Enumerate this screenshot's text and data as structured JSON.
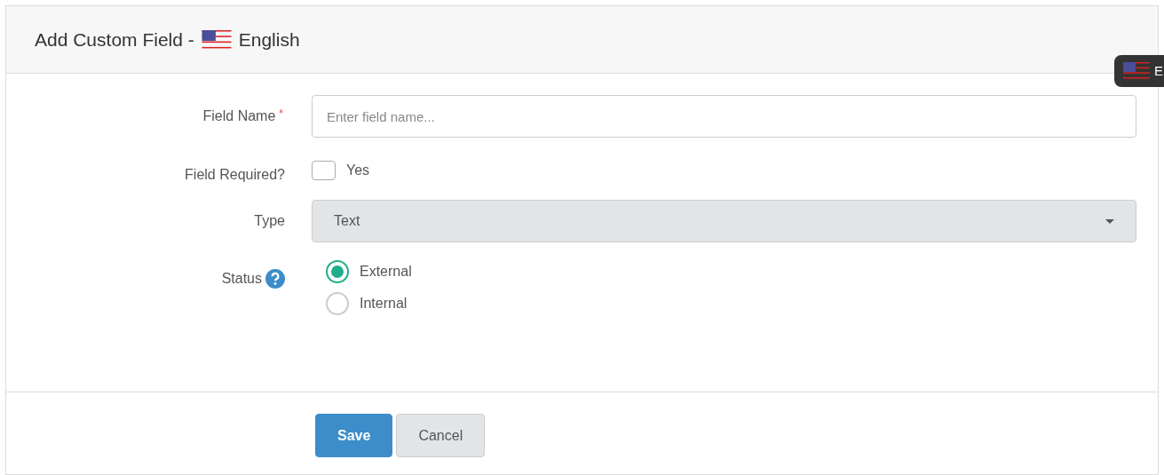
{
  "header": {
    "title": "Add Custom Field -",
    "language": "English"
  },
  "language_tab": {
    "label": "E"
  },
  "form": {
    "field_name": {
      "label": "Field Name",
      "required_mark": "*",
      "placeholder": "Enter field name..."
    },
    "field_required": {
      "label": "Field Required?",
      "option": "Yes",
      "checked": false
    },
    "type": {
      "label": "Type",
      "value": "Text",
      "disabled": true
    },
    "status": {
      "label": "Status",
      "options": [
        {
          "label": "External",
          "selected": true
        },
        {
          "label": "Internal",
          "selected": false
        }
      ]
    }
  },
  "buttons": [
    {
      "label": "Save",
      "kind": "primary"
    },
    {
      "label": "Cancel",
      "kind": "default"
    }
  ]
}
